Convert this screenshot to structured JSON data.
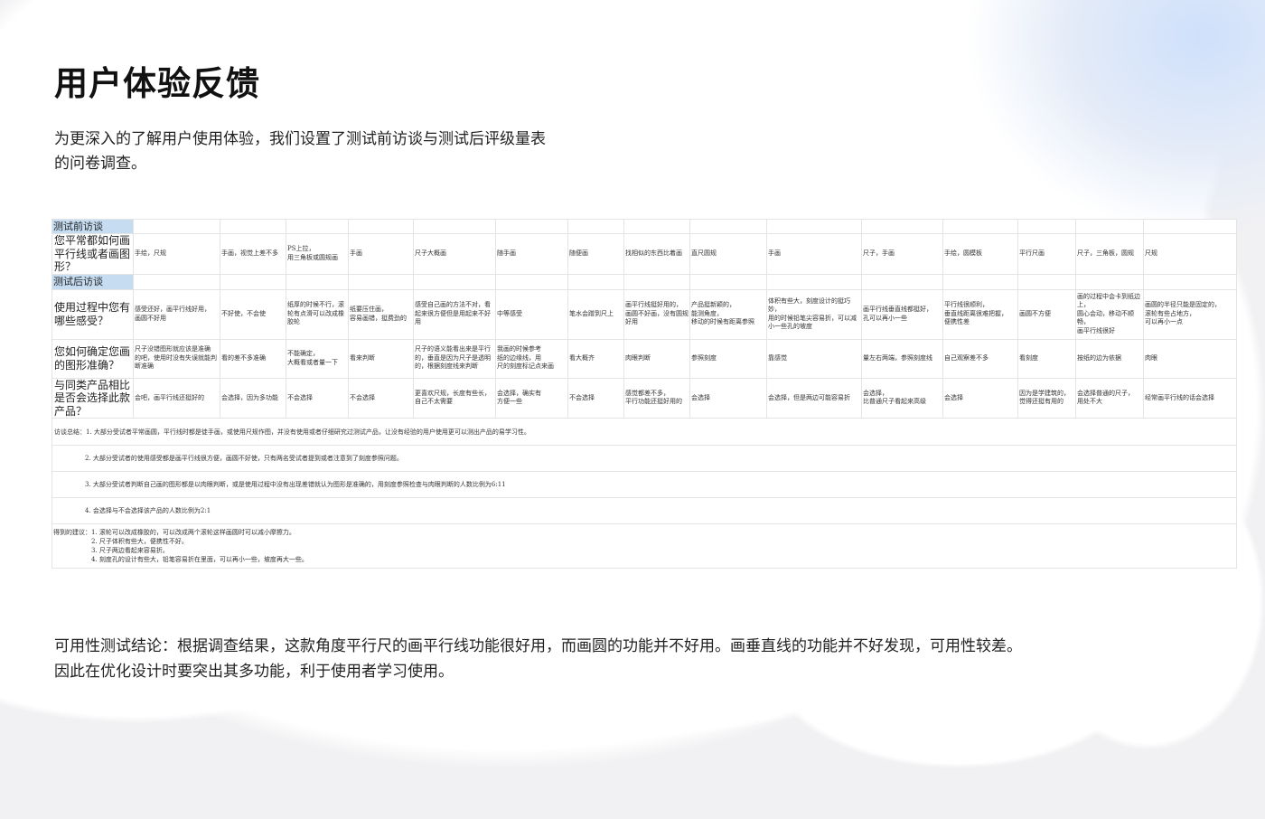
{
  "title": "用户体验反馈",
  "intro": "为更深入的了解用户使用体验，我们设置了测试前访谈与测试后评级量表的问卷调查。",
  "table": {
    "pre_section": "测试前访谈",
    "post_section": "测试后访谈",
    "rows": [
      {
        "question": "您平常都如何画平行线或者画图形？",
        "answers": [
          "手绘，尺规",
          "手画，视觉上差不多",
          "PS上拉，\n用三角板或圆规画",
          "手画",
          "尺子大概画",
          "随手画",
          "随便画",
          "找相似的东西比着画",
          "直尺圆规",
          "手画",
          "尺子，手画",
          "手绘，圆模板",
          "平行尺画",
          "尺子，三角板，圆规",
          "尺规"
        ]
      },
      {
        "question": "使用过程中您有哪些感受？",
        "answers": [
          "感受还好，画平行线好用，\n画圆不好用",
          "不好使，不会使",
          "纸厚的时候不行，滚轮有点滑可以改成橡胶轮",
          "纸要压住画，\n容易画错，挺费劲的",
          "感受自己画的方法不对，看起来很方便但是用起来不好用",
          "中等感受",
          "笔水会蹭到尺上",
          "画平行线挺好用的，\n画圆不好画，没有圆规好用",
          "产品挺新颖的，\n能测角度，\n移动的时候有距离参照",
          "体积有些大，刻度设计的挺巧妙，\n用的时候铅笔尖容易折，可以减小一些孔的坡度",
          "画平行线垂直线都挺好，\n孔可以再小一些",
          "平行线很顺利，\n垂直线距离很难把握，\n便携性差",
          "画圆不方便",
          "画的过程中会卡到纸边上，\n圆心会动，移动不顺畅，\n画平行线很好",
          "画圆的半径只能是固定的，\n滚轮有些占地方，\n可以再小一点"
        ]
      },
      {
        "question": "您如何确定您画的图形准确？",
        "answers": [
          "尺子没错图形就应该是准确\n的吧，使用时没有失误就能判断准确",
          "看的差不多准确",
          "不能确定，\n大概看或者量一下",
          "看来判断",
          "尺子的语义能看出来是平行的，垂直是因为尺子是透明的，根据刻度线来判断",
          "我画的时候参考\n纸的边缘线，用\n尺的刻度标记点来画",
          "看大概齐",
          "肉眼判断",
          "参照刻度",
          "靠感觉",
          "量左右两端，参照刻度线",
          "自己观察差不多",
          "看刻度",
          "按纸的边为依据",
          "肉眼"
        ]
      },
      {
        "question": "与同类产品相比是否会选择此款产品？",
        "answers": [
          "会吧，画平行线还挺好的",
          "会选择，因为多功能",
          "不会选择",
          "不会选择",
          "更喜欢尺规，长度有些长，自己不太需要",
          "会选择，确实有\n方便一些",
          "不会选择",
          "感觉都差不多，\n平行功能还挺好用的",
          "会选择",
          "会选择，但是两边可能容易折",
          "会选择，\n比普通尺子看起来高级",
          "会选择",
          "因为是学建筑的，\n觉得还挺有用的",
          "会选择普通的尺子，\n用处不大",
          "经常画平行线的话会选择"
        ]
      }
    ],
    "summary": [
      "访谈总结：1. 大部分受试者平常画圆，平行线时都是徒手画，或使用尺规作图，并没有使用或者仔细研究过测试产品，让没有经验的用户使用更可以测出产品的易学习性。",
      "2. 大部分受试者的使用感受都是画平行线很方便，画圆不好使，只有两名受试者提到或者注意到了刻度参照问题。",
      "3. 大部分受试者判断自己画的图形都是以肉眼判断，或是使用过程中没有出现差错就认为图形是准确的，用刻度参照检查与肉眼判断的人数比例为6:11",
      "4. 会选择与不会选择该产品的人数比例为2:1"
    ],
    "suggestions_label": "得到的建议：",
    "suggestions": [
      "1. 滚轮可以改成橡胶的，可以改成两个滚轮这样画圆时可以减小摩擦力。",
      "2. 尺子体积有些大，便携性不好。",
      "3. 尺子两边看起来容易折。",
      "4. 刻度孔的设计有些大，铅笔容易折在里面，可以再小一些，坡度再大一些。"
    ]
  },
  "conclusion": "可用性测试结论：根据调查结果，这款角度平行尺的画平行线功能很好用，而画圆的功能并不好用。画垂直线的功能并不好发现，可用性较差。因此在优化设计时要突出其多功能，利于使用者学习使用。"
}
